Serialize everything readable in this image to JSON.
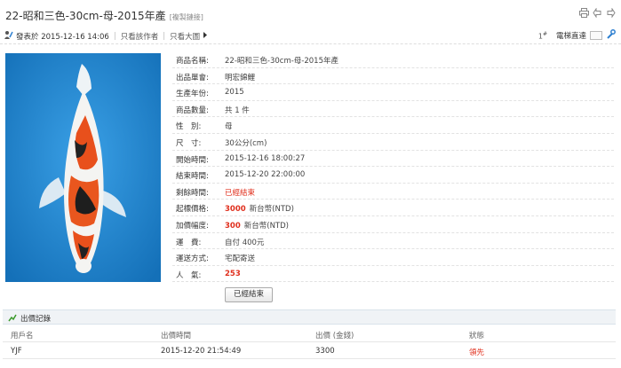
{
  "title": {
    "text": "22-昭和三色-30cm-母-2015年產",
    "copy_link": "[複製鏈接]"
  },
  "meta": {
    "posted": "發表於 2015-12-16 14:06",
    "only_author": "只看該作者",
    "only_images": "只看大圖",
    "floor": "1",
    "floor_mark": "#",
    "direct_floor": "電梯直達"
  },
  "info": [
    {
      "label": "商品名稱:",
      "value": "22-昭和三色-30cm-母-2015年產"
    },
    {
      "label": "出品單會:",
      "value": "明宏錦鯉"
    },
    {
      "label": "生產年份:",
      "value": "2015"
    },
    {
      "label": "商品數量:",
      "value": "共 1 件"
    },
    {
      "label": "性　別:",
      "value": "母"
    },
    {
      "label": "尺　寸:",
      "value": "30公分(cm)"
    },
    {
      "label": "開始時間:",
      "value": "2015-12-16 18:00:27"
    },
    {
      "label": "結束時間:",
      "value": "2015-12-20 22:00:00"
    },
    {
      "label": "剩餘時間:",
      "value": "已經結束"
    },
    {
      "label": "起標價格:",
      "value": "3000",
      "unit": "新台幣(NTD)"
    },
    {
      "label": "加價幅度:",
      "value": "300",
      "unit": "新台幣(NTD)"
    },
    {
      "label": "運　費:",
      "value": "自付 400元"
    },
    {
      "label": "運送方式:",
      "value": "宅配寄送"
    },
    {
      "label": "人　氣:",
      "value": "253"
    }
  ],
  "ended_button": "已經結束",
  "bids": {
    "title": "出價記錄",
    "headers": [
      "用戶名",
      "出價時間",
      "出價 (金錢)",
      "狀態"
    ],
    "rows": [
      {
        "user": "YJF",
        "time": "2015-12-20 21:54:49",
        "amount": "3300",
        "status": "領先"
      }
    ]
  },
  "colors": {
    "accent_red": "#e0301e",
    "water_blue": "#1f86cf"
  },
  "icons": [
    "print-icon",
    "prev-icon",
    "next-icon",
    "author-icon",
    "wrench-icon",
    "chart-icon"
  ]
}
